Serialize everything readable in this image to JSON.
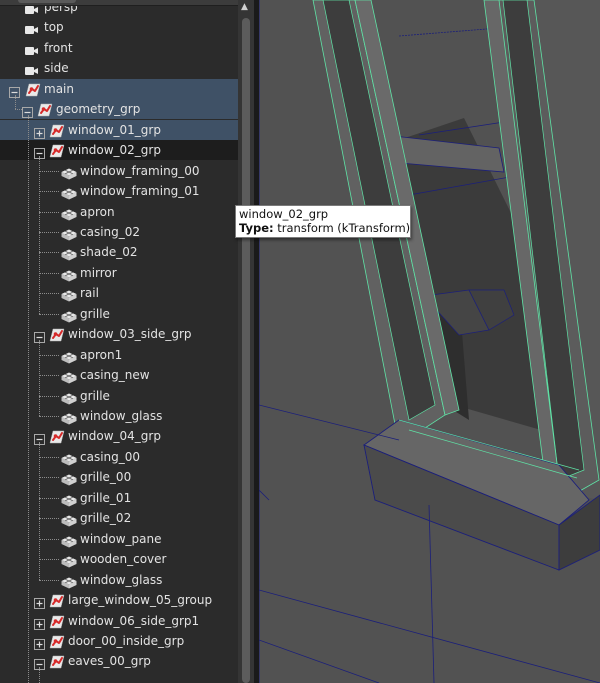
{
  "outliner": {
    "items": [
      {
        "label": "persp",
        "icon": "camera-icon",
        "indent": 0,
        "expander": "none",
        "highlight": "none"
      },
      {
        "label": "top",
        "icon": "camera-icon",
        "indent": 0,
        "expander": "none",
        "highlight": "none"
      },
      {
        "label": "front",
        "icon": "camera-icon",
        "indent": 0,
        "expander": "none",
        "highlight": "none"
      },
      {
        "label": "side",
        "icon": "camera-icon",
        "indent": 0,
        "expander": "none",
        "highlight": "none"
      },
      {
        "label": "main",
        "icon": "transform-group-icon",
        "indent": 0,
        "expander": "minus",
        "highlight": "hover"
      },
      {
        "label": "geometry_grp",
        "icon": "transform-group-icon",
        "indent": 1,
        "expander": "minus",
        "highlight": "hover"
      },
      {
        "label": "window_01_grp",
        "icon": "transform-group-icon",
        "indent": 2,
        "expander": "plus",
        "highlight": "hover"
      },
      {
        "label": "window_02_grp",
        "icon": "transform-group-icon",
        "indent": 2,
        "expander": "minus",
        "highlight": "selected"
      },
      {
        "label": "window_framing_00",
        "icon": "mesh-icon",
        "indent": 3,
        "expander": "none",
        "highlight": "none"
      },
      {
        "label": "window_framing_01",
        "icon": "mesh-icon",
        "indent": 3,
        "expander": "none",
        "highlight": "none"
      },
      {
        "label": "apron",
        "icon": "mesh-icon",
        "indent": 3,
        "expander": "none",
        "highlight": "none"
      },
      {
        "label": "casing_02",
        "icon": "mesh-icon",
        "indent": 3,
        "expander": "none",
        "highlight": "none"
      },
      {
        "label": "shade_02",
        "icon": "mesh-icon",
        "indent": 3,
        "expander": "none",
        "highlight": "none"
      },
      {
        "label": "mirror",
        "icon": "mesh-icon",
        "indent": 3,
        "expander": "none",
        "highlight": "none"
      },
      {
        "label": "rail",
        "icon": "mesh-icon",
        "indent": 3,
        "expander": "none",
        "highlight": "none"
      },
      {
        "label": "grille",
        "icon": "mesh-icon",
        "indent": 3,
        "expander": "none",
        "highlight": "none"
      },
      {
        "label": "window_03_side_grp",
        "icon": "transform-group-icon",
        "indent": 2,
        "expander": "minus",
        "highlight": "none"
      },
      {
        "label": "apron1",
        "icon": "mesh-icon",
        "indent": 3,
        "expander": "none",
        "highlight": "none"
      },
      {
        "label": "casing_new",
        "icon": "mesh-icon",
        "indent": 3,
        "expander": "none",
        "highlight": "none"
      },
      {
        "label": "grille",
        "icon": "mesh-icon",
        "indent": 3,
        "expander": "none",
        "highlight": "none"
      },
      {
        "label": "window_glass",
        "icon": "mesh-icon",
        "indent": 3,
        "expander": "none",
        "highlight": "none"
      },
      {
        "label": "window_04_grp",
        "icon": "transform-group-icon",
        "indent": 2,
        "expander": "minus",
        "highlight": "none"
      },
      {
        "label": "casing_00",
        "icon": "mesh-icon",
        "indent": 3,
        "expander": "none",
        "highlight": "none"
      },
      {
        "label": "grille_00",
        "icon": "mesh-icon",
        "indent": 3,
        "expander": "none",
        "highlight": "none"
      },
      {
        "label": "grille_01",
        "icon": "mesh-icon",
        "indent": 3,
        "expander": "none",
        "highlight": "none"
      },
      {
        "label": "grille_02",
        "icon": "mesh-icon",
        "indent": 3,
        "expander": "none",
        "highlight": "none"
      },
      {
        "label": "window_pane",
        "icon": "mesh-icon",
        "indent": 3,
        "expander": "none",
        "highlight": "none"
      },
      {
        "label": "wooden_cover",
        "icon": "mesh-icon",
        "indent": 3,
        "expander": "none",
        "highlight": "none"
      },
      {
        "label": "window_glass",
        "icon": "mesh-icon",
        "indent": 3,
        "expander": "none",
        "highlight": "none"
      },
      {
        "label": "large_window_05_group",
        "icon": "transform-group-icon",
        "indent": 2,
        "expander": "plus",
        "highlight": "none"
      },
      {
        "label": "window_06_side_grp1",
        "icon": "transform-group-icon",
        "indent": 2,
        "expander": "plus",
        "highlight": "none"
      },
      {
        "label": "door_00_inside_grp",
        "icon": "transform-group-icon",
        "indent": 2,
        "expander": "plus",
        "highlight": "none"
      },
      {
        "label": "eaves_00_grp",
        "icon": "transform-group-icon",
        "indent": 2,
        "expander": "minus",
        "highlight": "none"
      }
    ]
  },
  "tooltip": {
    "title": "window_02_grp",
    "type_label": "Type:",
    "type_value": "transform (kTransform)"
  },
  "colors": {
    "panel_bg": "#2b2b2b",
    "hover_row": "#3f5166",
    "selected_row": "#1d1d1d",
    "wireframe_green": "#5fe3a6",
    "wireframe_blue": "#1b1f7a",
    "transform_icon_red": "#d62b2b"
  }
}
